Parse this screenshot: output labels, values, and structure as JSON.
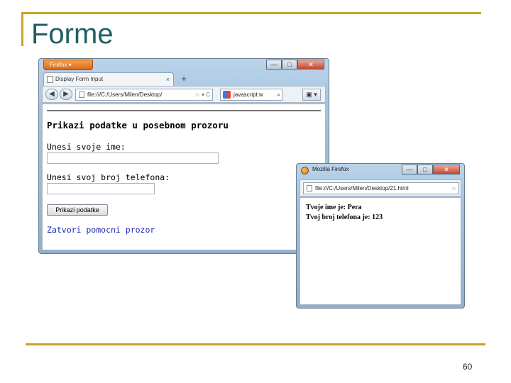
{
  "slide": {
    "title": "Forme",
    "page_number": "60"
  },
  "main_window": {
    "app_button": "Firefox ▾",
    "controls": {
      "minimize": "—",
      "maximize": "□",
      "close": "✕"
    },
    "tab": {
      "title": "Display Form Input",
      "close": "×",
      "new_tab": "+"
    },
    "nav": {
      "back": "◀",
      "forward": "▶",
      "url": "file:///C:/Users/Milen/Desktop/",
      "url_suffix": "☆ ▾ C",
      "search": "javascript:w",
      "search_go": "⌕",
      "bookmarks": "▣ ▾"
    },
    "page": {
      "heading": "Prikazi podatke u posebnom prozoru",
      "name_label": "Unesi svoje ime:",
      "name_value": "",
      "phone_label": "Unesi svoj broj telefona:",
      "phone_value": "",
      "submit_button": "Prikazi podatke",
      "close_link": "Zatvori pomocni prozor"
    }
  },
  "popup_window": {
    "title": "Mozilla Firefox",
    "controls": {
      "minimize": "—",
      "maximize": "□",
      "close": "✕"
    },
    "url": "file:///C:/Users/Milen/Desktop/21.html",
    "url_suffix": "☆",
    "line1": "Tvoje ime je: Pera",
    "line2": "Tvoj broj telefona je: 123"
  }
}
